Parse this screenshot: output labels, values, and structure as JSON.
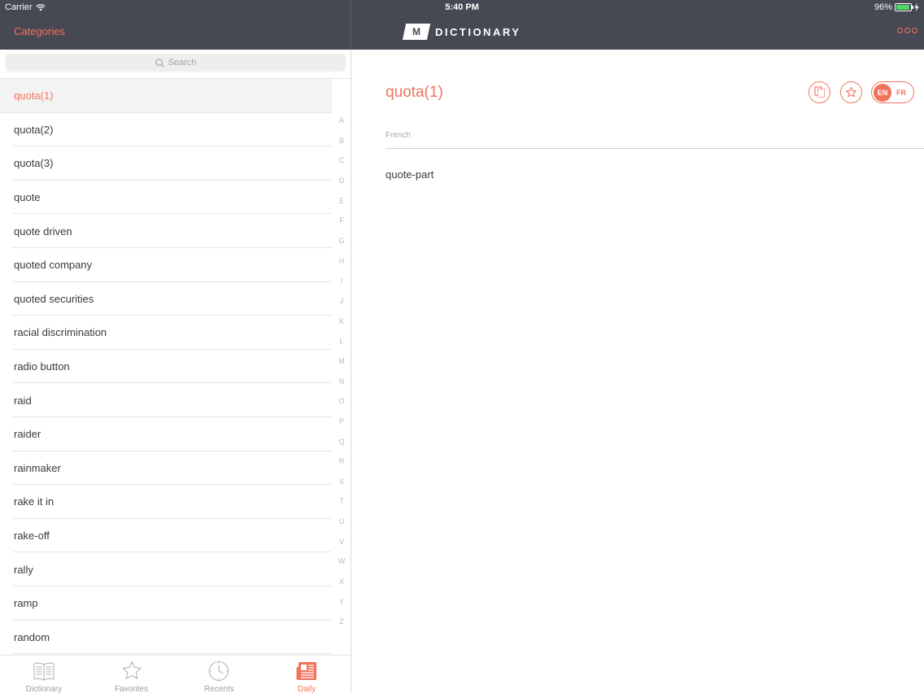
{
  "status_bar": {
    "carrier": "Carrier",
    "time": "5:40 PM",
    "battery": "96%",
    "battery_level": 0.96,
    "wifi_icon": "wifi-icon",
    "charging_icon": "bolt-icon"
  },
  "header": {
    "categories_label": "Categories",
    "logo_letter": "M",
    "logo_word": "DICTIONARY",
    "more_icon": "more-icon"
  },
  "search": {
    "placeholder": "Search",
    "icon": "search-icon"
  },
  "word_list": {
    "selected_index": 0,
    "items": [
      "quota(1)",
      "quota(2)",
      "quota(3)",
      "quote",
      "quote driven",
      "quoted company",
      "quoted securities",
      "racial discrimination",
      "radio button",
      "raid",
      "raider",
      "rainmaker",
      "rake it in",
      "rake-off",
      "rally",
      "ramp",
      "random"
    ]
  },
  "index_letters": [
    "A",
    "B",
    "C",
    "D",
    "E",
    "F",
    "G",
    "H",
    "I",
    "J",
    "K",
    "L",
    "M",
    "N",
    "O",
    "P",
    "Q",
    "R",
    "S",
    "T",
    "U",
    "V",
    "W",
    "X",
    "Y",
    "Z"
  ],
  "tabs": [
    {
      "label": "Dictionary",
      "icon": "book-icon",
      "active": false
    },
    {
      "label": "Favorites",
      "icon": "star-icon",
      "active": false
    },
    {
      "label": "Recents",
      "icon": "clock-icon",
      "active": false
    },
    {
      "label": "Daily",
      "icon": "newspaper-icon",
      "active": true
    }
  ],
  "entry": {
    "title": "quota(1)",
    "section_label": "French",
    "translation": "quote-part",
    "copy_icon": "copy-icon",
    "favorite_icon": "star-icon",
    "lang_left": "EN",
    "lang_right": "FR"
  },
  "colors": {
    "accent": "#f0735c",
    "header_bg": "#464853",
    "battery_green": "#4cd964"
  }
}
